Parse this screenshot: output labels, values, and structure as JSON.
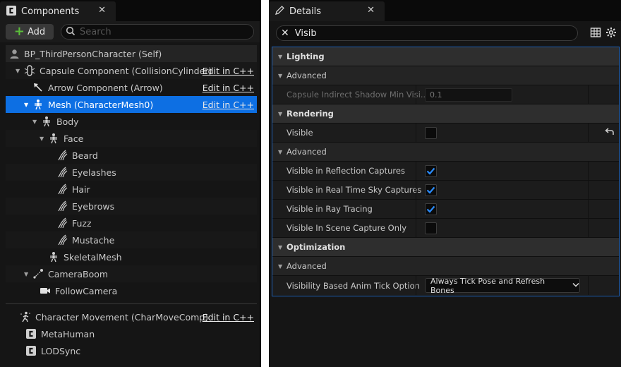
{
  "components": {
    "tab_title": "Components",
    "add_label": "Add",
    "search_placeholder": "Search",
    "self": "BP_ThirdPersonCharacter (Self)",
    "edit_label": "Edit in C++",
    "rows": [
      {
        "label": "Capsule Component (CollisionCylinder)",
        "edit": true
      },
      {
        "label": "Arrow Component (Arrow)",
        "edit": true
      },
      {
        "label": "Mesh (CharacterMesh0)",
        "edit": true
      },
      {
        "label": "Body"
      },
      {
        "label": "Face"
      },
      {
        "label": "Beard"
      },
      {
        "label": "Eyelashes"
      },
      {
        "label": "Hair"
      },
      {
        "label": "Eyebrows"
      },
      {
        "label": "Fuzz"
      },
      {
        "label": "Mustache"
      },
      {
        "label": "SkeletalMesh"
      },
      {
        "label": "CameraBoom"
      },
      {
        "label": "FollowCamera"
      }
    ],
    "bottom_rows": [
      {
        "label": "Character Movement (CharMoveComp)",
        "edit": true
      },
      {
        "label": "MetaHuman"
      },
      {
        "label": "LODSync"
      }
    ]
  },
  "details": {
    "tab_title": "Details",
    "search_value": "Visib",
    "lighting": {
      "label": "Lighting",
      "advanced": "Advanced",
      "shadow_label": "Capsule Indirect Shadow Min Visi...",
      "shadow_value": "0.1"
    },
    "rendering": {
      "label": "Rendering",
      "visible": "Visible",
      "advanced": "Advanced",
      "reflection": "Visible in Reflection Captures",
      "sky": "Visible in Real Time Sky Captures",
      "raytracing": "Visible in Ray Tracing",
      "scene_capture": "Visible In Scene Capture Only"
    },
    "optimization": {
      "label": "Optimization",
      "advanced": "Advanced",
      "anim_tick_label": "Visibility Based Anim Tick Option",
      "anim_tick_value": "Always Tick Pose and Refresh Bones"
    }
  },
  "colors": {
    "selection": "#0d6fe3",
    "accent": "#2a8cff",
    "add_plus": "#5bbf3a"
  }
}
